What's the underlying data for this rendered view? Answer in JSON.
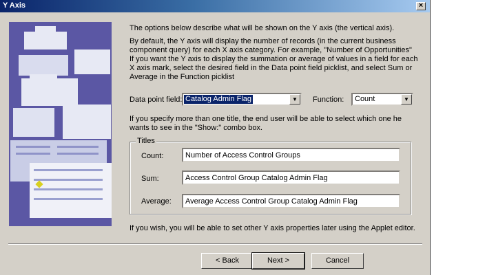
{
  "window": {
    "title": "Y Axis",
    "close_label": "×"
  },
  "intro": {
    "p1": "The options below describe what will be shown on the Y axis (the vertical axis).",
    "p2": "By default, the Y axis will display the number of records (in the current business component query) for each X axis category.  For example, \"Number of Opportunities\"",
    "p3": "If you want the Y axis to display the summation or average of values in a field for each X axis mark, select the desired field in the Data point field picklist, and select Sum or Average in the Function picklist"
  },
  "data_point": {
    "label": "Data point field:",
    "value": "Catalog Admin Flag"
  },
  "function": {
    "label": "Function:",
    "value": "Count"
  },
  "titles_note": "If you specify more than one title, the end user will be able to select which one he wants to see in the \"Show:\" combo box.",
  "titles": {
    "legend": "Titles",
    "count_label": "Count:",
    "count_value": "Number of Access Control Groups",
    "sum_label": "Sum:",
    "sum_value": "Access Control Group Catalog Admin Flag",
    "average_label": "Average:",
    "average_value": "Average Access Control Group Catalog Admin Flag"
  },
  "footer_note": "If you wish, you will be able to set other Y axis properties later using the Applet editor.",
  "buttons": {
    "back": "< Back",
    "next": "Next >",
    "cancel": "Cancel"
  }
}
